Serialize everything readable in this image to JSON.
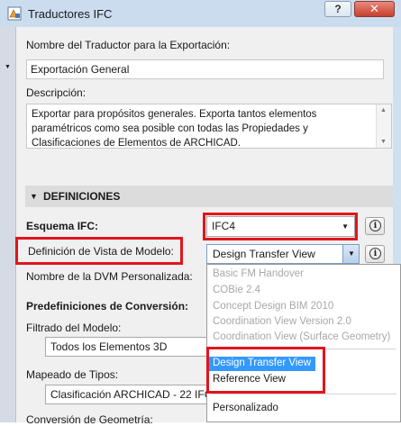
{
  "window": {
    "title": "Traductores IFC",
    "help_label": "?",
    "close_label": "✕"
  },
  "export_name": {
    "label": "Nombre del Traductor para la Exportación:",
    "value": "Exportación General"
  },
  "description": {
    "label": "Descripción:",
    "value": "Exportar para propósitos generales. Exporta tantos elementos paramétricos como sea posible con todas las Propiedades y Clasificaciones de Elementos de ARCHICAD."
  },
  "definitions": {
    "header": "DEFINICIONES",
    "ifc_schema": {
      "label": "Esquema IFC:",
      "value": "IFC4"
    },
    "mvd": {
      "label": "Definición de Vista de Modelo:",
      "value": "Design Transfer View"
    },
    "custom_mvd_name": {
      "label": "Nombre de la DVM Personalizada:"
    }
  },
  "conversion_presets": {
    "header": "Predefiniciones de Conversión:",
    "model_filter": {
      "label": "Filtrado del Modelo:",
      "value": "Todos los Elementos 3D"
    },
    "type_mapping": {
      "label": "Mapeado de Tipos:",
      "value": "Clasificación ARCHICAD - 22 IFC4"
    },
    "geometry_conversion": {
      "label": "Conversión de Geometría:"
    }
  },
  "mvd_options": {
    "disabled": [
      "Basic FM Handover",
      "COBie 2.4",
      "Concept Design BIM 2010",
      "Coordination View Version 2.0",
      "Coordination View (Surface Geometry)"
    ],
    "enabled": [
      "Design Transfer View",
      "Reference View"
    ],
    "selected": "Design Transfer View",
    "custom": "Personalizado"
  },
  "colors": {
    "accent_red": "#e2141c",
    "title_bar": "#cbdcef",
    "selection": "#3399ff"
  }
}
